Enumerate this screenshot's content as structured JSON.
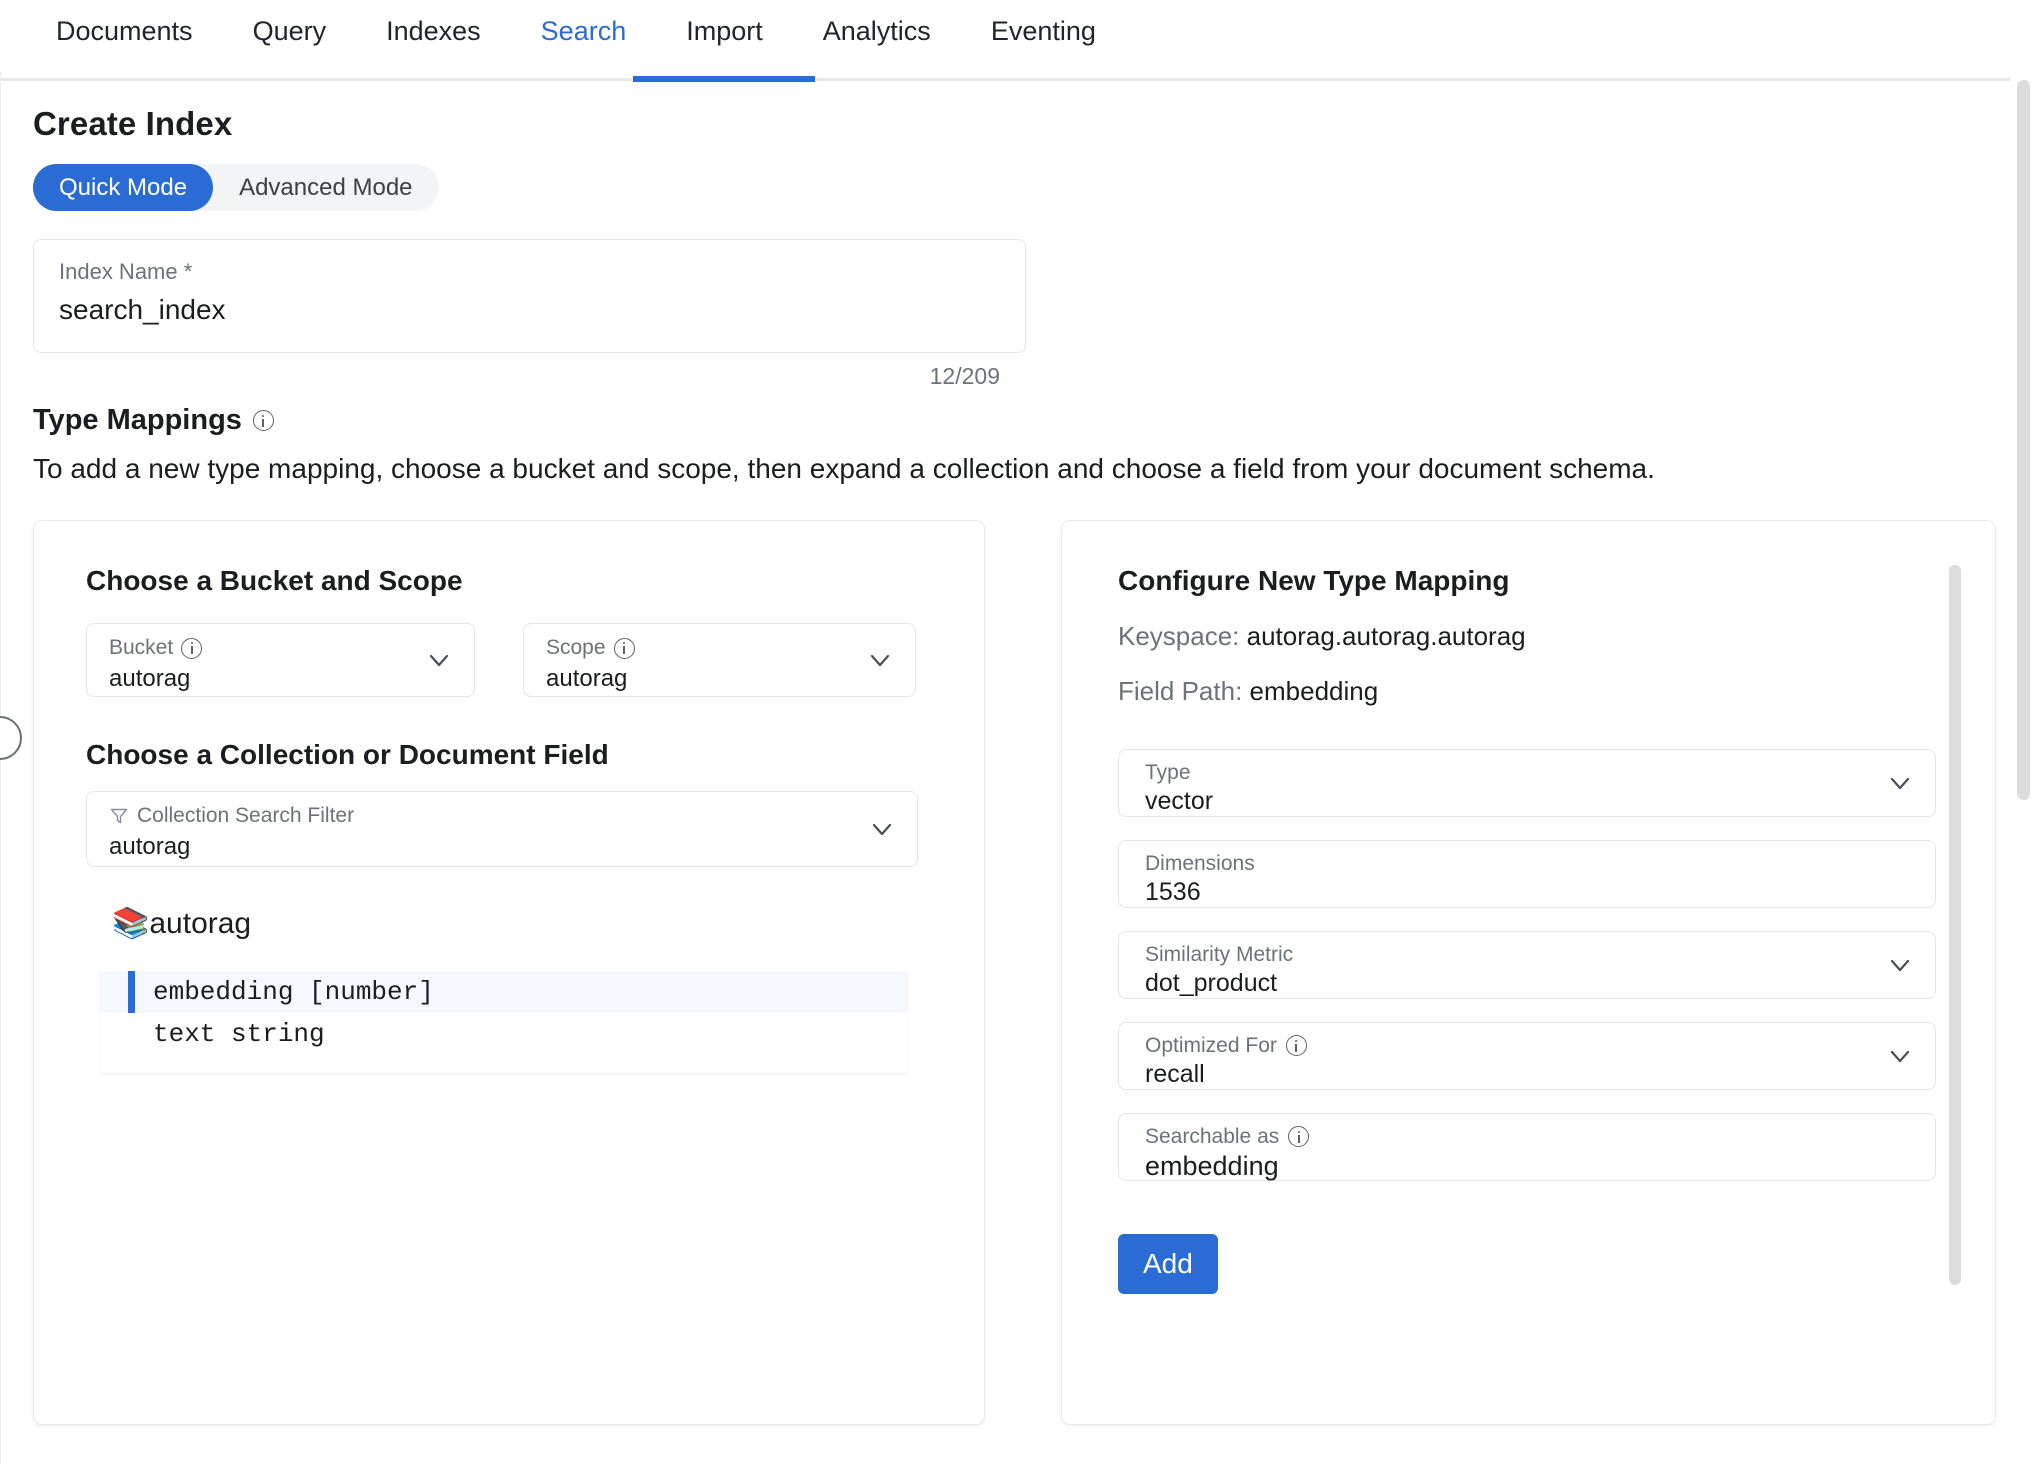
{
  "nav": {
    "tabs": [
      {
        "label": "Documents",
        "active": false
      },
      {
        "label": "Query",
        "active": false
      },
      {
        "label": "Indexes",
        "active": false
      },
      {
        "label": "Search",
        "active": true
      },
      {
        "label": "Import",
        "active": false
      },
      {
        "label": "Analytics",
        "active": false
      },
      {
        "label": "Eventing",
        "active": false
      }
    ]
  },
  "page": {
    "title": "Create Index",
    "mode_toggle": {
      "quick_label": "Quick Mode",
      "advanced_label": "Advanced Mode",
      "selected": "Quick Mode"
    },
    "index_name": {
      "label": "Index Name *",
      "value": "search_index",
      "placeholder": "Index Name",
      "counter": "12/209"
    },
    "type_mappings": {
      "heading": "Type Mappings",
      "info_icon": "info-icon",
      "description": "To add a new type mapping, choose a bucket and scope, then expand a collection and choose a field from your document schema."
    }
  },
  "left_panel": {
    "bucket_scope_title": "Choose a Bucket and Scope",
    "bucket": {
      "label": "Bucket",
      "value": "autorag",
      "info_icon": "info-icon",
      "chevron": "chevron-down-icon"
    },
    "scope": {
      "label": "Scope",
      "value": "autorag",
      "info_icon": "info-icon",
      "chevron": "chevron-down-icon"
    },
    "collection_title": "Choose a Collection or Document Field",
    "collection_filter": {
      "label": "Collection Search Filter",
      "value": "autorag",
      "placeholder": "Collection Search Filter",
      "filter_icon": "funnel-icon",
      "chevron": "chevron-down-icon"
    },
    "collection": {
      "icon": "books-icon",
      "icon_glyph": "📚",
      "name": "autorag"
    },
    "fields": [
      {
        "text": "embedding [number]",
        "selected": true
      },
      {
        "text": "text string",
        "selected": false
      }
    ]
  },
  "right_panel": {
    "title": "Configure New Type Mapping",
    "keyspace_label": "Keyspace:",
    "keyspace_value": "autorag.autorag.autorag",
    "field_path_label": "Field Path:",
    "field_path_value": "embedding",
    "fields": [
      {
        "name": "type",
        "label": "Type",
        "value": "vector",
        "control": "select",
        "has_info": false,
        "chevron": "chevron-down-icon"
      },
      {
        "name": "dimensions",
        "label": "Dimensions",
        "value": "1536",
        "control": "input",
        "has_info": false
      },
      {
        "name": "similarity-metric",
        "label": "Similarity Metric",
        "value": "dot_product",
        "control": "select",
        "has_info": false,
        "chevron": "chevron-down-icon"
      },
      {
        "name": "optimized-for",
        "label": "Optimized For",
        "value": "recall",
        "control": "select",
        "has_info": true,
        "chevron": "chevron-down-icon"
      },
      {
        "name": "searchable-as",
        "label": "Searchable as",
        "value": "embedding",
        "control": "input",
        "has_info": true
      }
    ],
    "add_button": "Add"
  },
  "colors": {
    "accent_blue": "#2b6cd4",
    "text_primary": "#1b1d21",
    "text_muted": "#6d7278",
    "border": "#e3e5e8",
    "selected_row_bg": "#f5f8fd",
    "toggle_track": "#f3f4f5",
    "scrollbar": "#dcdcdc"
  }
}
